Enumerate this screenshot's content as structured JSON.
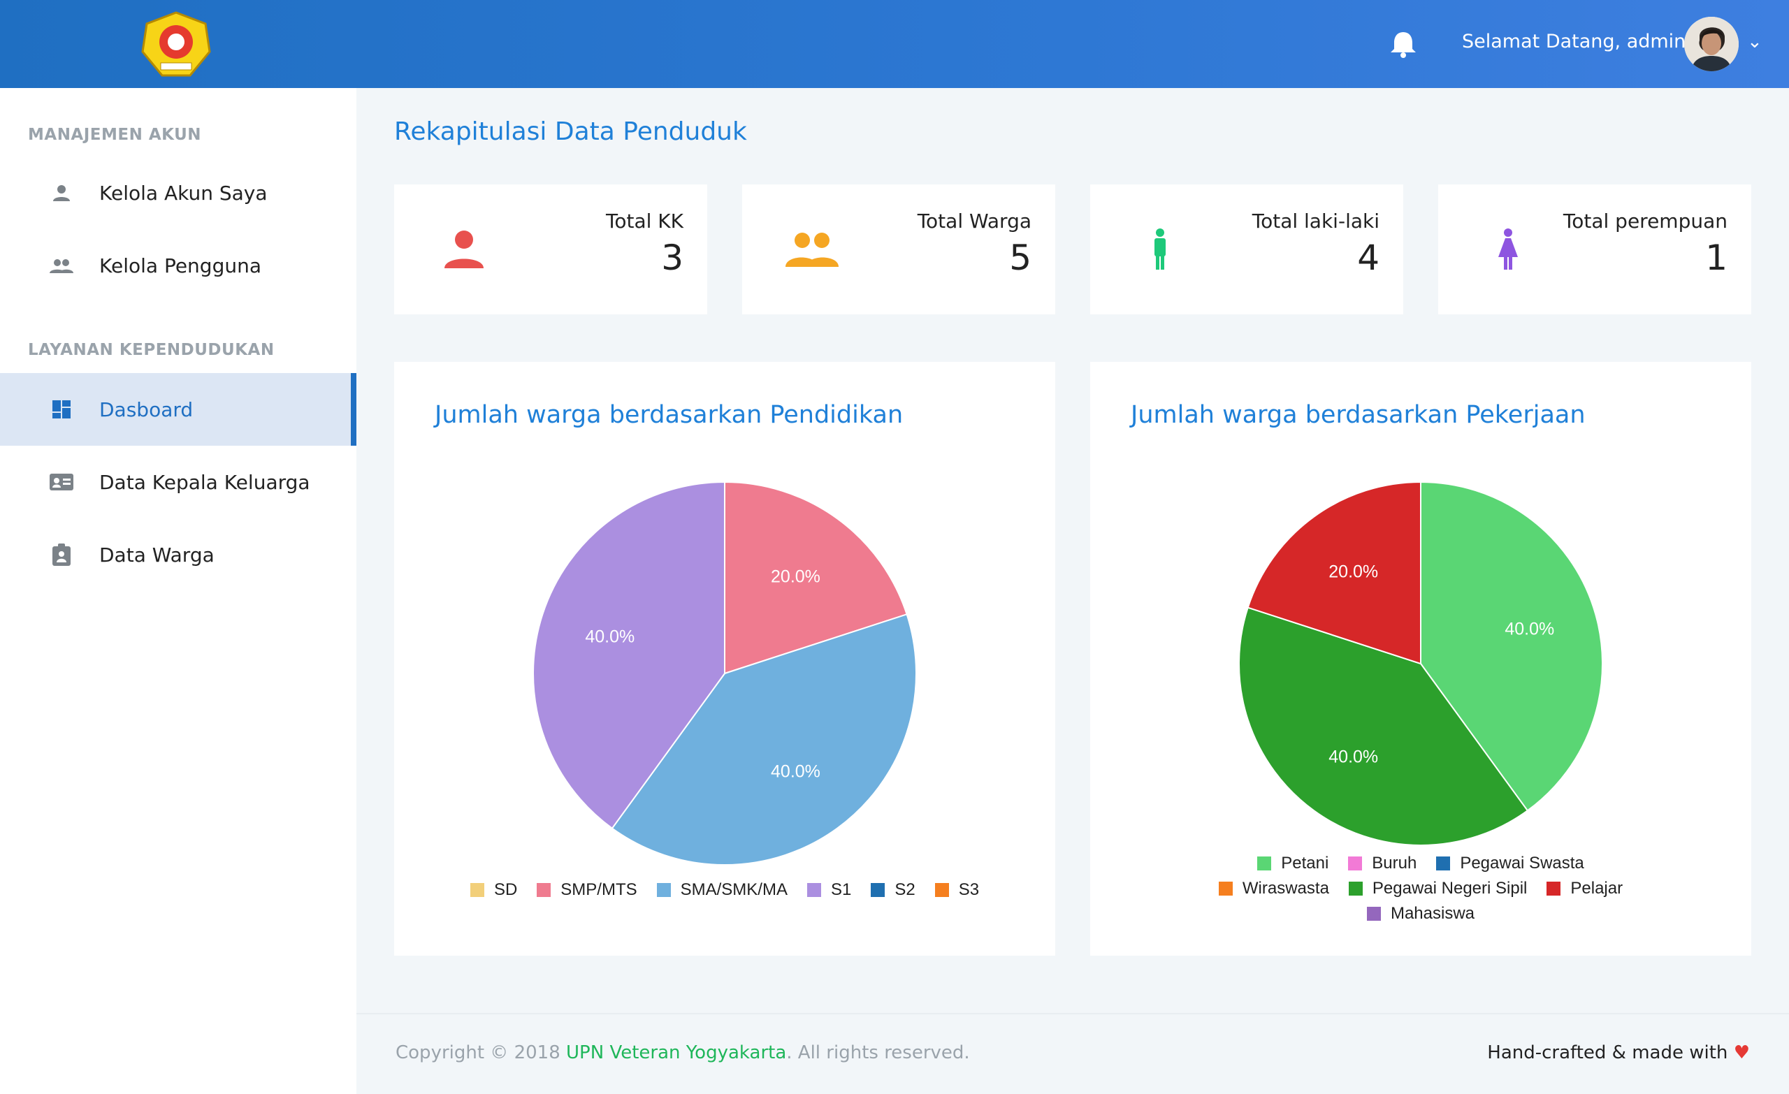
{
  "header": {
    "logo_alt": "UPN Veteran logo",
    "welcome": "Selamat Datang, admin",
    "bell_icon": "bell-icon",
    "caret": "⌄"
  },
  "sidebar": {
    "sections": [
      {
        "title": "MANAJEMEN AKUN"
      },
      {
        "title": "LAYANAN KEPENDUDUKAN"
      }
    ],
    "items": [
      {
        "label": "Kelola Akun Saya",
        "icon": "person-icon"
      },
      {
        "label": "Kelola Pengguna",
        "icon": "people-icon"
      },
      {
        "label": "Dasboard",
        "icon": "dashboard-icon",
        "active": true
      },
      {
        "label": "Data Kepala Keluarga",
        "icon": "id-card-icon"
      },
      {
        "label": "Data Warga",
        "icon": "clipboard-person-icon"
      }
    ]
  },
  "main": {
    "title": "Rekapitulasi Data Penduduk",
    "stats": [
      {
        "label": "Total KK",
        "value": "3",
        "icon": "person-icon",
        "color": "#e8514e"
      },
      {
        "label": "Total Warga",
        "value": "5",
        "icon": "people-icon",
        "color": "#f5a623"
      },
      {
        "label": "Total laki-laki",
        "value": "4",
        "icon": "male-icon",
        "color": "#1ec97a"
      },
      {
        "label": "Total perempuan",
        "value": "1",
        "icon": "female-icon",
        "color": "#8e55e0"
      }
    ]
  },
  "chart_data": [
    {
      "type": "pie",
      "title": "Jumlah warga berdasarkan Pendidikan",
      "categories": [
        "SD",
        "SMP/MTS",
        "SMA/SMK/MA",
        "S1",
        "S2",
        "S3"
      ],
      "values": [
        0,
        1,
        2,
        2,
        0,
        0
      ],
      "percent_labels": [
        "",
        "20.0%",
        "40.0%",
        "40.0%",
        "",
        ""
      ],
      "colors": [
        "#f2cf7a",
        "#ef7b8f",
        "#6fb0de",
        "#ab8fe0",
        "#1f6fb0",
        "#f57f1f"
      ],
      "legend": "bottom"
    },
    {
      "type": "pie",
      "title": "Jumlah warga berdasarkan Pekerjaan",
      "categories": [
        "Petani",
        "Buruh",
        "Pegawai Swasta",
        "Wiraswasta",
        "Pegawai Negeri Sipil",
        "Pelajar",
        "Mahasiswa"
      ],
      "values": [
        2,
        0,
        0,
        0,
        2,
        1,
        0
      ],
      "percent_labels": [
        "40.0%",
        "",
        "",
        "",
        "40.0%",
        "20.0%",
        ""
      ],
      "colors": [
        "#5ad674",
        "#f27ad6",
        "#1f6fb0",
        "#f57f1f",
        "#2ca02c",
        "#d62728",
        "#9467bd"
      ],
      "legend": "bottom"
    }
  ],
  "footer": {
    "copyright_prefix": "Copyright © 2018 ",
    "brand": "UPN Veteran Yogyakarta",
    "copyright_suffix": ". All rights reserved.",
    "made": "Hand-crafted & made with ",
    "heart": "♥"
  }
}
